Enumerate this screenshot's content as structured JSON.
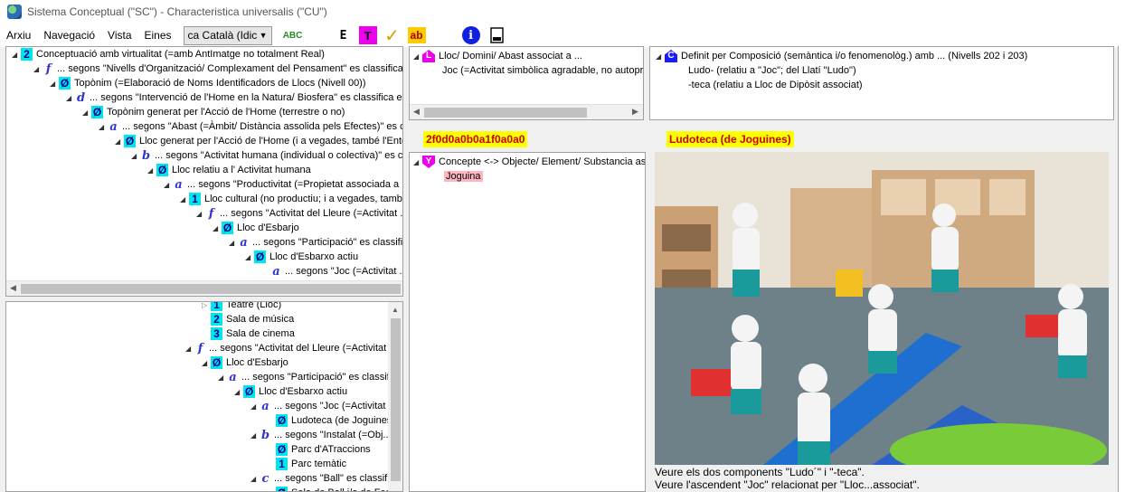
{
  "window": {
    "title": "Sistema Conceptual (\"SC\") - Characteristica universalis (\"CU\")"
  },
  "menu": {
    "items": [
      "Arxiu",
      "Navegació",
      "Vista",
      "Eines"
    ],
    "language": "ca Català (Idic",
    "toolbar": {
      "spell_label": "ABC",
      "tree_label": "E",
      "t_label": "T",
      "check_label": "✓",
      "ab_label": "ab",
      "info_label": "i"
    }
  },
  "tree_top": [
    {
      "badge": "2",
      "text": "Conceptuació amb virtualitat (=amb AntImatge no totalment Real)"
    },
    {
      "letter": "f",
      "text": "... segons \"Nivells d'Organització/ Complexament del Pensament\" es classifica en ..."
    },
    {
      "badge": "Ø",
      "text": "Topònim (=Elaboració de Noms Identificadors de Llocs (Nivell 00))"
    },
    {
      "letter": "d",
      "text": "... segons \"Intervenció de l'Home en la Natura/ Biosfera\" es classifica en ..."
    },
    {
      "badge": "Ø",
      "text": "Topònim generat per l'Acció de l'Home (terrestre o no)"
    },
    {
      "letter": "a",
      "text": "... segons \"Abast (=Àmbit/ Distància assolida pels Efectes)\" es classifica en ..."
    },
    {
      "badge": "Ø",
      "text": "Lloc generat per l'Acció de l'Home (i a vegades, també l'Entorn)"
    },
    {
      "letter": "b",
      "text": "... segons \"Activitat humana (individual o colectiva)\" es classifica en ..."
    },
    {
      "badge": "Ø",
      "text": "Lloc relatiu a l' Activitat humana"
    },
    {
      "letter": "a",
      "text": "... segons \"Productivitat (=Propietat associada a ...)\" es classifica en ..."
    },
    {
      "badge": "1",
      "text": "Lloc cultural (no productiu; i a vegades, també ...)"
    },
    {
      "letter": "f",
      "text": "... segons \"Activitat del Lleure (=Activitat ...)\" es classifica en ..."
    },
    {
      "badge": "Ø",
      "text": "Lloc d'Esbarjo"
    },
    {
      "letter": "a",
      "text": "... segons \"Participació\" es classifica en ..."
    },
    {
      "badge": "Ø",
      "text": "Lloc d'Esbarxo actiu"
    },
    {
      "letter": "a",
      "text": "... segons \"Joc (=Activitat ...)\" es classifica en ..."
    }
  ],
  "tree_bottom": [
    {
      "badge": "1",
      "text": "Teatre (Lloc)"
    },
    {
      "badge": "2",
      "text": "Sala de música"
    },
    {
      "badge": "3",
      "text": "Sala de cinema"
    },
    {
      "letter": "f",
      "text": "... segons \"Activitat del Lleure (=Activitat ...)\" es classifica en ..."
    },
    {
      "badge": "Ø",
      "text": "Lloc d'Esbarjo"
    },
    {
      "letter": "a",
      "text": "... segons \"Participació\" es classifica en ..."
    },
    {
      "badge": "Ø",
      "text": "Lloc d'Esbarxo actiu"
    },
    {
      "letter": "a",
      "text": "... segons \"Joc (=Activitat ...)\" es classifica en ..."
    },
    {
      "badge": "Ø",
      "text": "Ludoteca (de Joguines)"
    },
    {
      "letter": "b",
      "text": "... segons \"Instalat (=Obj...)\" es classifica en ..."
    },
    {
      "badge": "Ø",
      "text": "Parc d'ATraccions"
    },
    {
      "badge": "1",
      "text": "Parc temàtic"
    },
    {
      "letter": "c",
      "text": "... segons \"Ball\" es classifica en ..."
    },
    {
      "badge": "Ø",
      "text": "Sala de Ball i/o de Festa"
    }
  ],
  "mid_top": {
    "header": "Lloc/ Domini/ Abast associat a ...",
    "item": "Joc (=Activitat simbòlica agradable, no autopropulsada)"
  },
  "right_top": {
    "header": "Definit per Composició (semàntica i/o fenomenològ.) amb ... (Nivells 202 i 203)",
    "items": [
      "Ludo- (relatiu a \"Joc\"; del Llatí \"Ludo\")",
      "-teca (relatiu a Lloc de Dipòsit associat)"
    ]
  },
  "code": "2f0d0a0b0a1f0a0a0",
  "concept_name": "Ludoteca (de Joguines)",
  "mid_bottom": {
    "header": "Concepte <-> Objecte/ Element/ Substancia associada ...",
    "item": "Joguina"
  },
  "captions": [
    "Veure els dos components \"Ludo´\" i \"-teca\".",
    "Veure l'ascendent \"Joc\" relacionat per \"Lloc...associat\"."
  ],
  "colors": {
    "badge": "#00e5ee",
    "highlight": "#ffff00",
    "code_text": "#cc0000",
    "pink": "#ffb6c1"
  }
}
